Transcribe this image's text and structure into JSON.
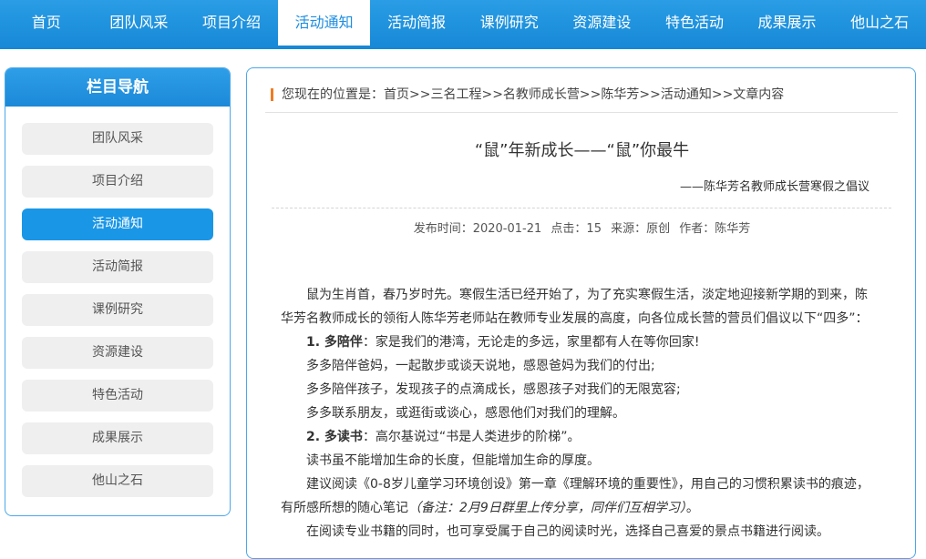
{
  "topnav": {
    "items": [
      "首页",
      "团队风采",
      "项目介绍",
      "活动通知",
      "活动简报",
      "课例研究",
      "资源建设",
      "特色活动",
      "成果展示",
      "他山之石"
    ],
    "active": "活动通知"
  },
  "sidebar": {
    "title": "栏目导航",
    "items": [
      "团队风采",
      "项目介绍",
      "活动通知",
      "活动简报",
      "课例研究",
      "资源建设",
      "特色活动",
      "成果展示",
      "他山之石"
    ]
  },
  "breadcrumb": {
    "text": "您现在的位置是：首页>>三名工程>>名教师成长营>>陈华芳>>活动通知>>文章内容"
  },
  "article": {
    "title": "“鼠”年新成长——“鼠”你最牛",
    "subtitle": "——陈华芳名教师成长营寒假之倡议",
    "meta": {
      "date": "发布时间：2020-01-21",
      "clicks": "点击：15",
      "source": "来源：原创",
      "author": "作者：陈华芳"
    },
    "intro": "鼠为生肖首，春乃岁时先。寒假生活已经开始了，为了充实寒假生活，淡定地迎接新学期的到来，陈华芳名教师成长的领衔人陈华芳老师站在教师专业发展的高度，向各位成长营的营员们倡议以下“四多”：",
    "s1_head": "1. 多陪伴",
    "s1_tail": "：家是我们的港湾，无论走的多远，家里都有人在等你回家!",
    "s1_lines": [
      "多多陪伴爸妈，一起散步或谈天说地，感恩爸妈为我们的付出;",
      "多多陪伴孩子，发现孩子的点滴成长，感恩孩子对我们的无限宽容;",
      "多多联系朋友，或逛街或谈心，感恩他们对我们的理解。"
    ],
    "s2_head": "2. 多读书",
    "s2_tail": "：高尔基说过“书是人类进步的阶梯”。",
    "s2_line1": "读书虽不能增加生命的长度，但能增加生命的厚度。",
    "s2_line2": "建议阅读《0-8岁儿童学习环境创设》第一章《理解环境的重要性》，用自己的习惯积累读书的痕迹，有所感所想的随心笔记",
    "s2_note": "（备注：2月9日群里上传分享，同伴们互相学习）",
    "s2_end": "。",
    "s2_line3": "在阅读专业书籍的同时，也可享受属于自己的阅读时光，选择自己喜爱的景点书籍进行阅读。"
  }
}
